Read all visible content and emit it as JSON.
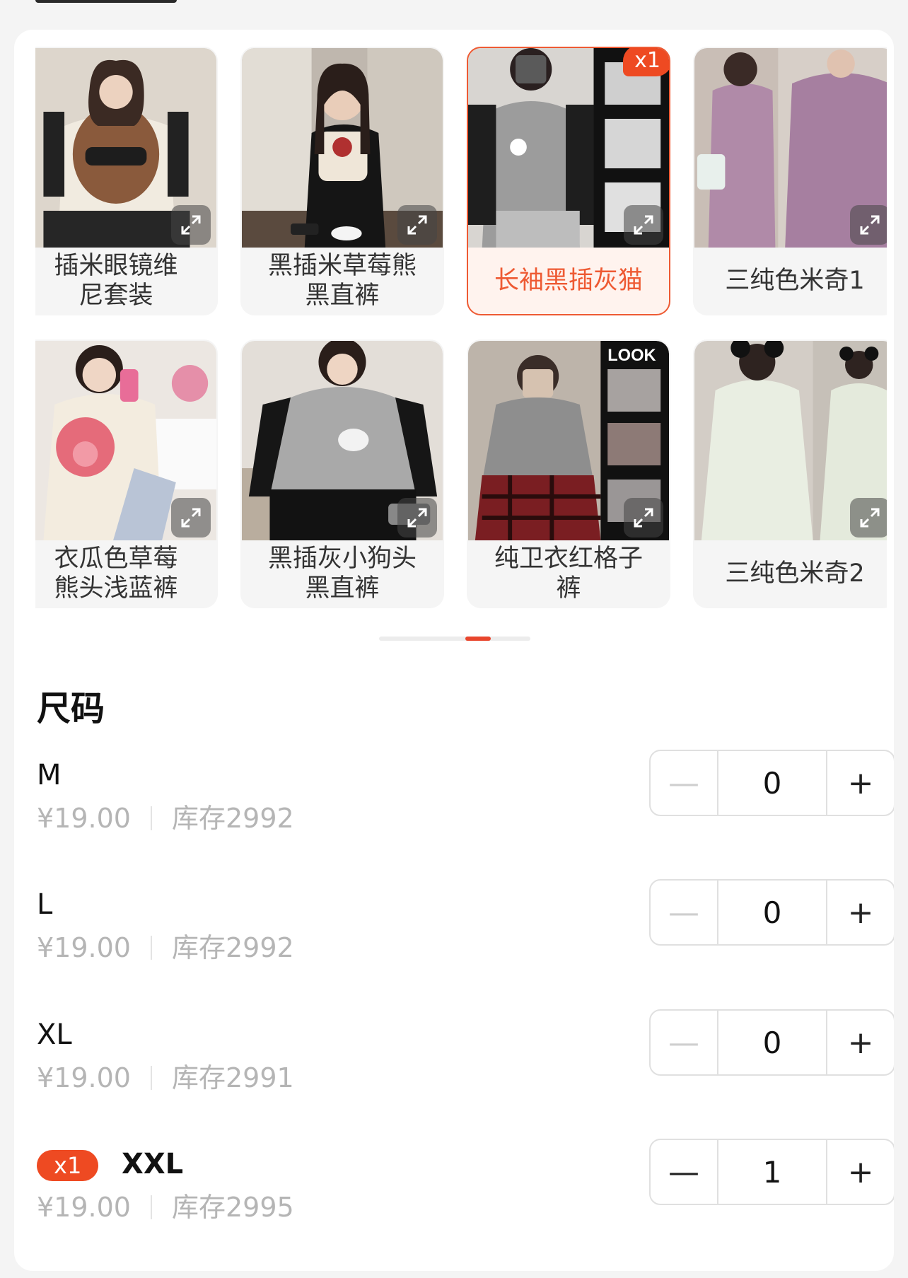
{
  "variants": [
    {
      "label": "插米眼镜维\n尼套装",
      "selected": false,
      "badge": ""
    },
    {
      "label": "黑插米草莓熊\n黑直裤",
      "selected": false,
      "badge": ""
    },
    {
      "label": "长袖黑插灰猫",
      "selected": true,
      "badge": "x1"
    },
    {
      "label": "三纯色米奇1",
      "selected": false,
      "badge": ""
    },
    {
      "label": "衣瓜色草莓\n熊头浅蓝裤",
      "selected": false,
      "badge": ""
    },
    {
      "label": "黑插灰小狗头\n黑直裤",
      "selected": false,
      "badge": ""
    },
    {
      "label": "纯卫衣红格子\n裤",
      "selected": false,
      "badge": ""
    },
    {
      "label": "三纯色米奇2",
      "selected": false,
      "badge": ""
    }
  ],
  "thumb_text": {
    "look": "LOOK"
  },
  "pager": {
    "pages": 2,
    "active": 1
  },
  "size_section": {
    "title": "尺码"
  },
  "sizes": [
    {
      "name": "M",
      "price": "¥19.00",
      "stock": "库存2992",
      "qty": "0",
      "badge": ""
    },
    {
      "name": "L",
      "price": "¥19.00",
      "stock": "库存2992",
      "qty": "0",
      "badge": ""
    },
    {
      "name": "XL",
      "price": "¥19.00",
      "stock": "库存2991",
      "qty": "0",
      "badge": ""
    },
    {
      "name": "XXL",
      "price": "¥19.00",
      "stock": "库存2995",
      "qty": "1",
      "badge": "x1"
    }
  ],
  "stepper": {
    "minus": "—",
    "plus": "+"
  },
  "colors": {
    "accent": "#ee4a22",
    "selected_bg": "#fff3ee",
    "muted": "#b5b5b5"
  },
  "icons": {
    "expand": "expand-icon",
    "minus": "minus-icon",
    "plus": "plus-icon"
  }
}
